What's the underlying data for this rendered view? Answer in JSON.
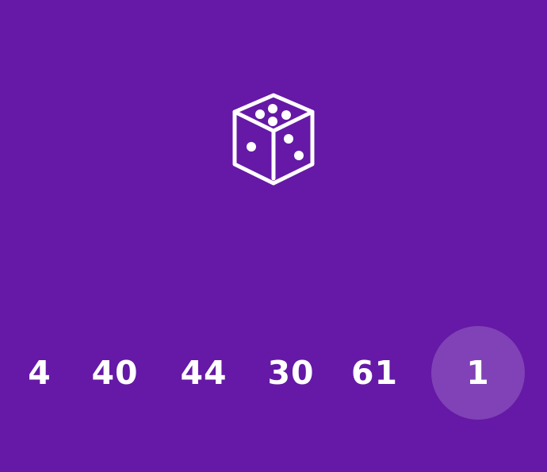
{
  "theme": {
    "background": "#6519a6",
    "foreground": "#ffffff",
    "selected_circle": "rgba(255,255,255,0.18)"
  },
  "dice": {
    "icon": "dice-icon"
  },
  "numbers": [
    {
      "value": "4"
    },
    {
      "value": "40"
    },
    {
      "value": "44"
    },
    {
      "value": "30"
    },
    {
      "value": "61"
    },
    {
      "value": "1",
      "selected": true
    }
  ]
}
